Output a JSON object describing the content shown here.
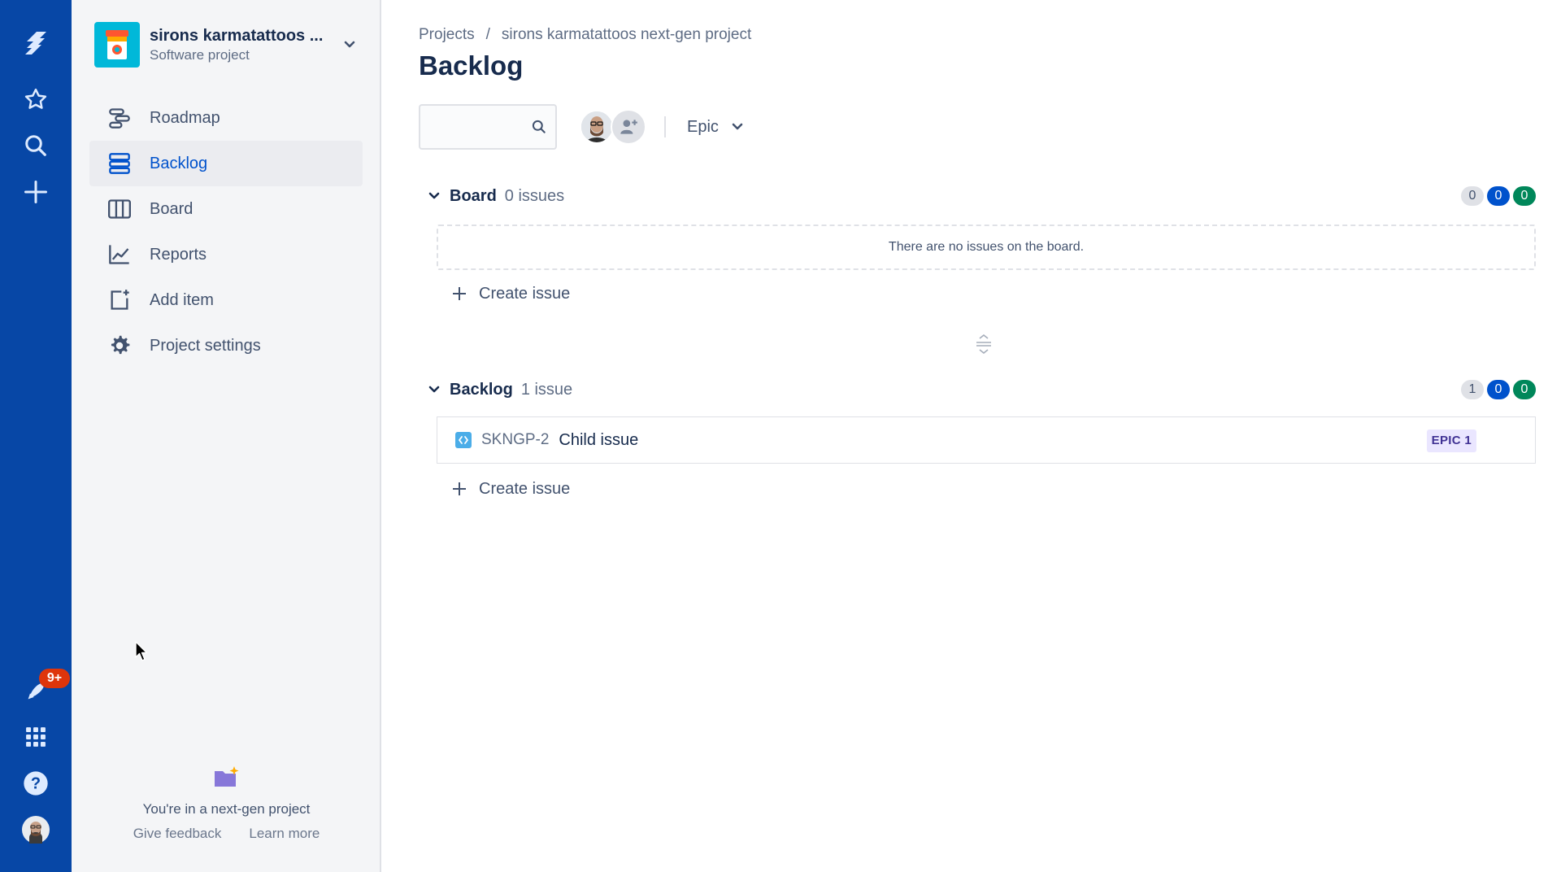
{
  "global_nav": {
    "notification_count": "9+",
    "icons": [
      "jira-logo-icon",
      "star-icon",
      "search-icon",
      "plus-icon",
      "rocket-icon",
      "app-switcher-icon",
      "help-icon",
      "user-avatar"
    ]
  },
  "project": {
    "name": "sirons karmatattoos ...",
    "type": "Software project"
  },
  "sidebar": {
    "items": [
      {
        "label": "Roadmap",
        "icon": "roadmap-icon",
        "active": false
      },
      {
        "label": "Backlog",
        "icon": "backlog-icon",
        "active": true
      },
      {
        "label": "Board",
        "icon": "board-icon",
        "active": false
      },
      {
        "label": "Reports",
        "icon": "reports-icon",
        "active": false
      },
      {
        "label": "Add item",
        "icon": "add-item-icon",
        "active": false
      },
      {
        "label": "Project settings",
        "icon": "gear-icon",
        "active": false
      }
    ],
    "footer": {
      "message": "You're in a next-gen project",
      "give_feedback": "Give feedback",
      "learn_more": "Learn more"
    }
  },
  "breadcrumb": {
    "root": "Projects",
    "separator": "/",
    "project": "sirons karmatattoos next-gen project"
  },
  "page_title": "Backlog",
  "toolbar": {
    "search_placeholder": "",
    "epic_filter_label": "Epic"
  },
  "board": {
    "title": "Board",
    "count": "0 issues",
    "badges": [
      "0",
      "0",
      "0"
    ],
    "empty_message": "There are no issues on the board.",
    "create_label": "Create issue"
  },
  "backlog": {
    "title": "Backlog",
    "count": "1 issue",
    "badges": [
      "1",
      "0",
      "0"
    ],
    "issues": [
      {
        "key": "SKNGP-2",
        "summary": "Child issue",
        "epic": "EPIC 1"
      }
    ],
    "create_label": "Create issue"
  },
  "colors": {
    "global_nav": "#0747a6",
    "sidebar_bg": "#f4f5f7",
    "active_link": "#0052cc",
    "badge_blue": "#0052cc",
    "badge_green": "#00875a",
    "epic_bg": "#eae6ff",
    "epic_text": "#403294"
  }
}
